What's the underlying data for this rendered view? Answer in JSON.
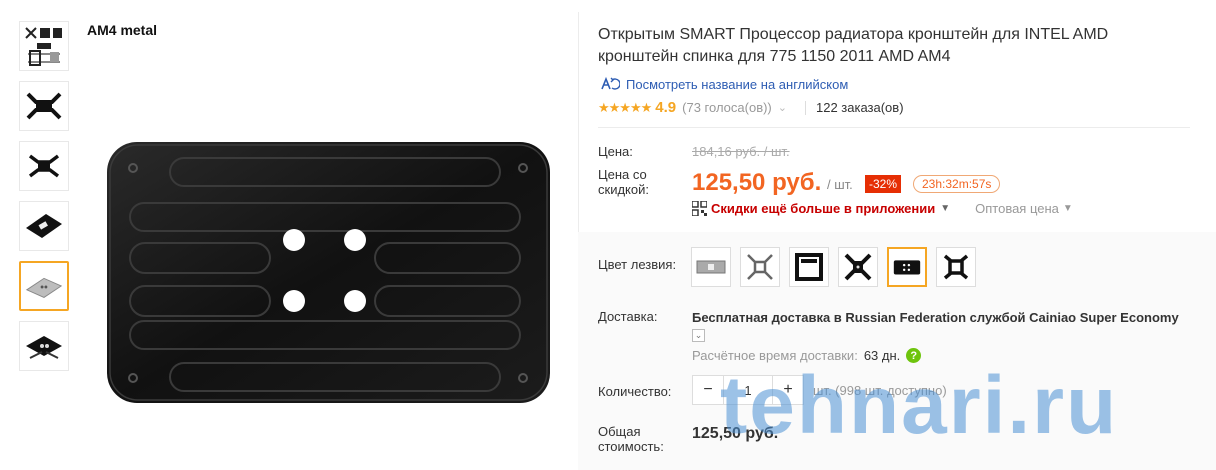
{
  "gallery": {
    "caption": "AM4 metal",
    "thumbnails": [
      "kit",
      "bracket-x",
      "bracket-narrow",
      "plate-dark",
      "plate-silver",
      "bracket-set"
    ],
    "active_thumbnail": 4
  },
  "product": {
    "title": "Открытым SMART Процессор радиатора кронштейн для INTEL AMD кронштейн спинка для 775 1150 2011 AMD AM4",
    "translate_link": "Посмотреть название на английском",
    "rating": "4.9",
    "stars": "★★★★★",
    "votes": "(73 голоса(ов))",
    "orders": "122 заказа(ов)"
  },
  "price": {
    "label": "Цена:",
    "old": "184,16 руб. / шт.",
    "discount_label": "Цена со скидкой:",
    "new": "125,50 руб.",
    "per_unit": "/ шт.",
    "discount_badge": "-32%",
    "timer": "23h:32m:57s",
    "app_promo": "Скидки ещё больше в приложении",
    "wholesale": "Оптовая цена"
  },
  "options": {
    "color_label": "Цвет лезвия:",
    "swatches": [
      "silver-plate",
      "bracket-x",
      "black-frame",
      "black-cross",
      "black-plate",
      "black-bracket"
    ],
    "active_swatch": 4
  },
  "delivery": {
    "label": "Доставка:",
    "text": "Бесплатная доставка в Russian Federation службой Cainiao Super Economy",
    "eta_label": "Расчётное время доставки:",
    "eta_value": "63 дн."
  },
  "quantity": {
    "label": "Количество:",
    "value": "1",
    "minus": "−",
    "plus": "+",
    "stock": "шт. (998 шт. доступно)"
  },
  "total": {
    "label": "Общая стоимость:",
    "value": "125,50 руб."
  },
  "watermark": "tehnari.ru",
  "colors": {
    "accent": "#f26522",
    "star": "#f5a623",
    "link": "#2e5db3",
    "promo": "#c70000"
  }
}
